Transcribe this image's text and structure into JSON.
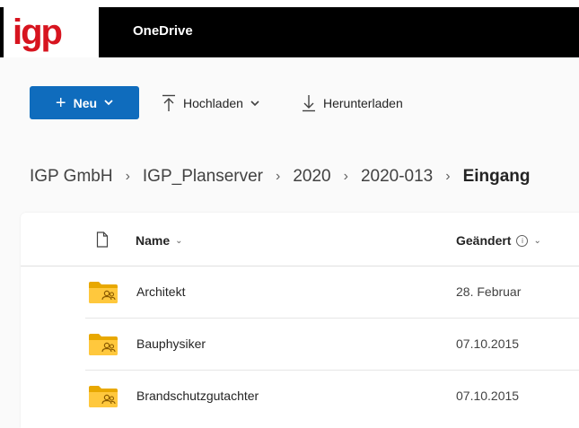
{
  "logo": {
    "text": "igp",
    "color": "#d7141f"
  },
  "app": {
    "title": "OneDrive"
  },
  "toolbar": {
    "new_label": "Neu",
    "upload_label": "Hochladen",
    "download_label": "Herunterladen",
    "accent": "#0f6cbd"
  },
  "breadcrumb": {
    "items": [
      "IGP GmbH",
      "IGP_Planserver",
      "2020",
      "2020-013"
    ],
    "current": "Eingang"
  },
  "list": {
    "columns": {
      "name": "Name",
      "modified": "Geändert"
    },
    "rows": [
      {
        "name": "Architekt",
        "modified": "28. Februar",
        "icon": "shared-folder-icon"
      },
      {
        "name": "Bauphysiker",
        "modified": "07.10.2015",
        "icon": "shared-folder-icon"
      },
      {
        "name": "Brandschutzgutachter",
        "modified": "07.10.2015",
        "icon": "shared-folder-icon"
      }
    ]
  }
}
